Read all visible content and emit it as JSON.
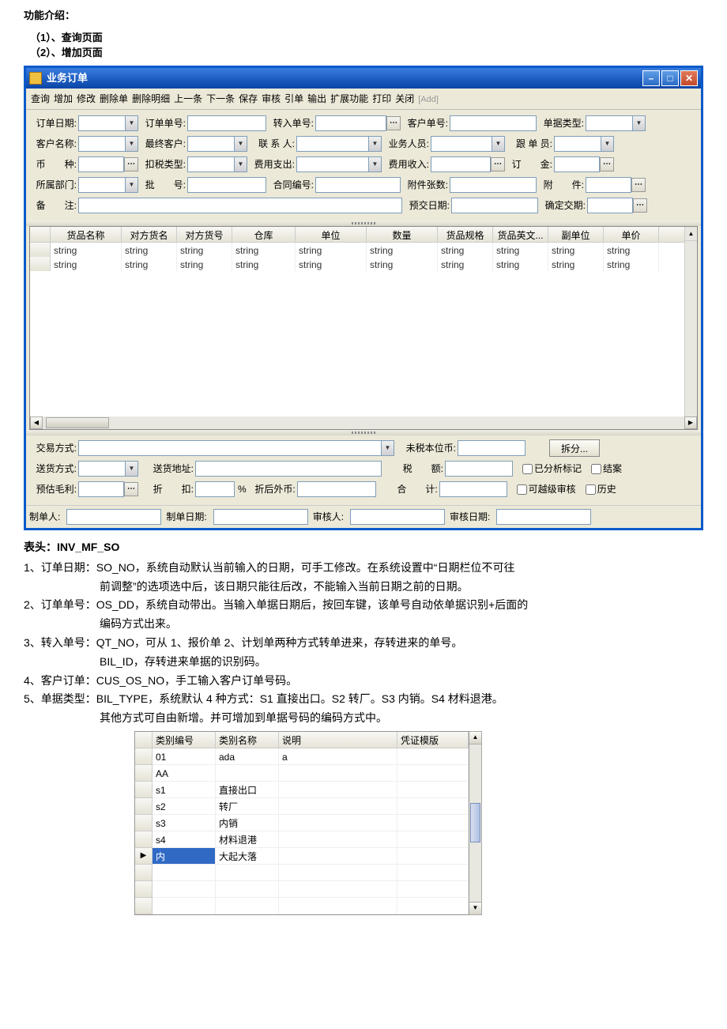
{
  "intro": {
    "title": "功能介绍：",
    "item1": "（1）、查询页面",
    "item2": "（2）、增加页面"
  },
  "window": {
    "title": "业务订单",
    "toolbar": [
      "查询",
      "增加",
      "修改",
      "删除单",
      "删除明细",
      "上一条",
      "下一条",
      "保存",
      "审核",
      "引单",
      "输出",
      "扩展功能",
      "打印",
      "关闭"
    ],
    "toolbar_addtag": "[Add]"
  },
  "form": {
    "r1": {
      "order_date_label": "订单日期:",
      "order_no_label": "订单单号:",
      "transfer_no_label": "转入单号:",
      "cust_no_label": "客户单号:",
      "doc_type_label": "单据类型:"
    },
    "r2": {
      "cust_name_label": "客户名称:",
      "end_cust_label": "最终客户:",
      "contact_label": "联 系 人:",
      "sales_label": "业务人员:",
      "tracker_label": "跟 单 员:"
    },
    "r3": {
      "currency_label": "币　　种:",
      "tax_type_label": "扣税类型:",
      "expense_out_label": "费用支出:",
      "expense_in_label": "费用收入:",
      "deposit_label": "订　　金:"
    },
    "r4": {
      "dept_label": "所属部门:",
      "batch_label": "批　　号:",
      "contract_label": "合同编号:",
      "attach_count_label": "附件张数:",
      "attach_label": "附　　件:"
    },
    "r5": {
      "remark_label": "备　　注:",
      "pre_delivery_label": "预交日期:",
      "confirm_delivery_label": "确定交期:"
    }
  },
  "grid": {
    "headers": [
      "货品名称",
      "对方货名",
      "对方货号",
      "仓库",
      "单位",
      "数量",
      "货品规格",
      "货品英文...",
      "副单位",
      "单价"
    ],
    "widths": [
      90,
      70,
      70,
      80,
      90,
      90,
      70,
      70,
      70,
      70
    ],
    "rows": [
      [
        "string",
        "string",
        "string",
        "string",
        "string",
        "string",
        "string",
        "string",
        "string",
        "string"
      ],
      [
        "string",
        "string",
        "string",
        "string",
        "string",
        "string",
        "string",
        "string",
        "string",
        "string"
      ]
    ]
  },
  "bottom": {
    "trade_mode_label": "交易方式:",
    "untaxed_label": "未税本位币:",
    "split_btn": "拆分...",
    "ship_mode_label": "送货方式:",
    "ship_addr_label": "送货地址:",
    "tax_label": "税　　额:",
    "analyzed_label": "已分析标记",
    "closed_label": "结案",
    "gross_label": "预估毛利:",
    "discount_label": "折　　扣:",
    "percent": "%",
    "after_disc_label": "折后外币:",
    "total_label": "合　　计:",
    "over_audit_label": "可越级审核",
    "history_label": "历史"
  },
  "status": {
    "maker_label": "制单人:",
    "make_date_label": "制单日期:",
    "auditor_label": "审核人:",
    "audit_date_label": "审核日期:"
  },
  "doc": {
    "header": "表头：INV_MF_SO",
    "p1a": "1、订单日期：SO_NO，系统自动默认当前输入的日期，可手工修改。在系统设置中“日期栏位不可往",
    "p1b": "前调整”的选项选中后，该日期只能往后改，不能输入当前日期之前的日期。",
    "p2a": "2、订单单号：OS_DD，系统自动带出。当输入单据日期后，按回车键，该单号自动依单据识别+后面的",
    "p2b": "编码方式出来。",
    "p3a": "3、转入单号：QT_NO，可从 1、报价单 2、计划单两种方式转单进来，存转进来的单号。",
    "p3b": "BIL_ID，存转进来单据的识别码。",
    "p4": "4、客户订单：CUS_OS_NO，手工输入客户订单号码。",
    "p5a": "5、单据类型：BIL_TYPE，系统默认 4 种方式：S1 直接出口。S2 转厂。S3 内销。S4 材料退港。",
    "p5b": "其他方式可自由新增。并可增加到单据号码的编码方式中。"
  },
  "subgrid": {
    "headers": [
      "类别编号",
      "类别名称",
      "说明",
      "凭证模版"
    ],
    "widths": [
      80,
      80,
      150,
      90
    ],
    "rows": [
      {
        "code": "01",
        "name": "ada",
        "desc": "a",
        "tpl": ""
      },
      {
        "code": "AA",
        "name": "",
        "desc": "",
        "tpl": ""
      },
      {
        "code": "s1",
        "name": "直接出口",
        "desc": "",
        "tpl": ""
      },
      {
        "code": "s2",
        "name": "转厂",
        "desc": "",
        "tpl": ""
      },
      {
        "code": "s3",
        "name": "内销",
        "desc": "",
        "tpl": ""
      },
      {
        "code": "s4",
        "name": "材料退港",
        "desc": "",
        "tpl": ""
      },
      {
        "code": "内",
        "name": "大起大落",
        "desc": "",
        "tpl": "",
        "active": true
      },
      {
        "code": "",
        "name": "",
        "desc": "",
        "tpl": ""
      },
      {
        "code": "",
        "name": "",
        "desc": "",
        "tpl": ""
      },
      {
        "code": "",
        "name": "",
        "desc": "",
        "tpl": ""
      }
    ]
  }
}
